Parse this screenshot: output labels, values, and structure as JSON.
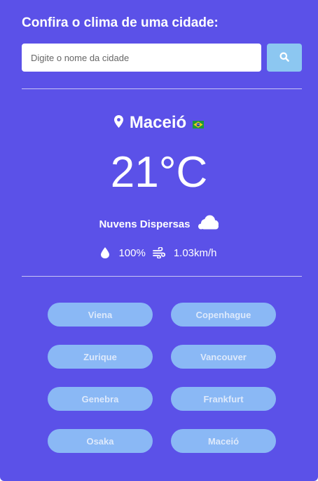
{
  "header": {
    "title": "Confira o clima de uma cidade:"
  },
  "search": {
    "placeholder": "Digite o nome da cidade",
    "value": "",
    "button_icon": "search-icon"
  },
  "weather": {
    "city": "Maceió",
    "country_flag": "brazil-flag-icon",
    "temperature": "21°C",
    "description": "Nuvens Dispersas",
    "description_icon": "cloud-icon",
    "humidity": "100%",
    "humidity_icon": "droplet-icon",
    "wind": "1.03km/h",
    "wind_icon": "wind-icon"
  },
  "suggestions": [
    {
      "label": "Viena"
    },
    {
      "label": "Copenhague"
    },
    {
      "label": "Zurique"
    },
    {
      "label": "Vancouver"
    },
    {
      "label": "Genebra"
    },
    {
      "label": "Frankfurt"
    },
    {
      "label": "Osaka"
    },
    {
      "label": "Maceió"
    }
  ],
  "colors": {
    "background": "#5b51e8",
    "search_button": "#8cc7f1",
    "city_button": "#8ab8f5",
    "text": "#ffffff"
  }
}
